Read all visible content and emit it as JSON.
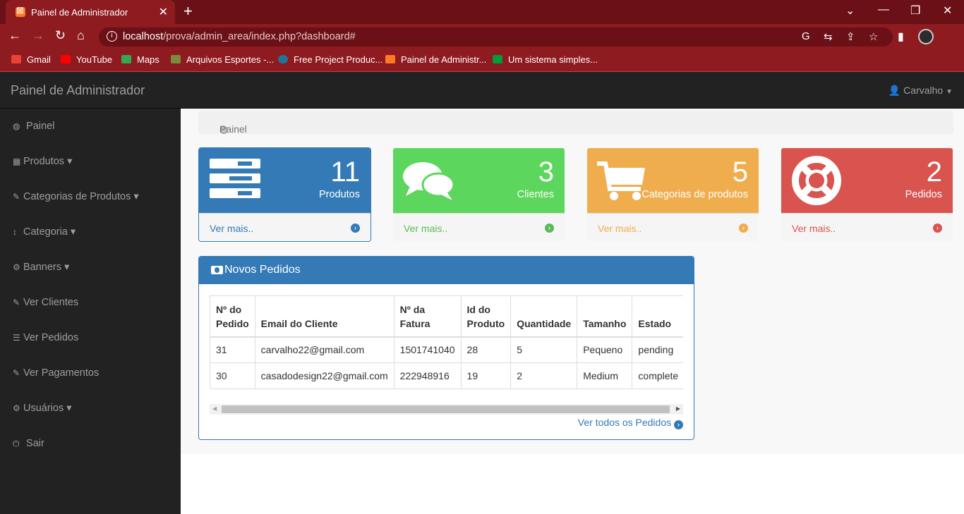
{
  "browser": {
    "tab_title": "Painel de Administrador",
    "tab_close": "✕",
    "new_tab": "+",
    "url_host": "localhost",
    "url_path": "/prova/admin_area/index.php?dashboard#",
    "bookmarks": [
      {
        "label": "Gmail",
        "color": "#ea4335"
      },
      {
        "label": "YouTube",
        "color": "#ff0000"
      },
      {
        "label": "Maps",
        "color": "#34a853"
      },
      {
        "label": "Arquivos Esportes -...",
        "color": "#7a8c3a"
      },
      {
        "label": "Free Project Produc...",
        "color": "#21759b"
      },
      {
        "label": "Painel de Administr...",
        "color": "#fb7a24"
      },
      {
        "label": "Um sistema simples...",
        "color": "#009b3a"
      }
    ]
  },
  "app": {
    "brand": "Painel de Administrador",
    "user": "Carvalho"
  },
  "sidebar": {
    "items": [
      {
        "label": "Painel",
        "icon": "dashboard-icon",
        "glyph": "◍"
      },
      {
        "label": "Produtos",
        "icon": "table-icon",
        "glyph": "▦"
      },
      {
        "label": "Categorias de Produtos",
        "icon": "pencil-icon",
        "glyph": "✎"
      },
      {
        "label": "Categoria",
        "icon": "resize-vertical-icon",
        "glyph": "↕"
      },
      {
        "label": "Banners",
        "icon": "cog-icon",
        "glyph": "⚙"
      },
      {
        "label": "Ver Clientes",
        "icon": "edit-icon",
        "glyph": "✎"
      },
      {
        "label": "Ver Pedidos",
        "icon": "list-icon",
        "glyph": "☰"
      },
      {
        "label": "Ver Pagamentos",
        "icon": "pencil-icon",
        "glyph": "✎"
      },
      {
        "label": "Usuários",
        "icon": "gear-icon",
        "glyph": "⚙"
      },
      {
        "label": "Sair",
        "icon": "power-icon",
        "glyph": "⏻"
      }
    ],
    "caret": "▾"
  },
  "breadcrumb": {
    "label": "Painel"
  },
  "cards": [
    {
      "count": "11",
      "label": "Produtos",
      "more": "Ver mais..",
      "color": "#337ab7",
      "text": "#337ab7",
      "icon": "tasks-icon"
    },
    {
      "count": "3",
      "label": "Clientes",
      "more": "Ver mais..",
      "color": "#5cd65c",
      "text": "#5cb85c",
      "icon": "comments-icon"
    },
    {
      "count": "5",
      "label": "Categorias de produtos",
      "more": "Ver mais..",
      "color": "#f0ad4e",
      "text": "#f0ad4e",
      "icon": "shopping-cart-icon"
    },
    {
      "count": "2",
      "label": "Pedidos",
      "more": "Ver mais..",
      "color": "#d9534f",
      "text": "#d9534f",
      "icon": "life-ring-icon"
    }
  ],
  "orders": {
    "title": "Novos Pedidos",
    "headers": [
      "Nº do Pedido",
      "Email do Cliente",
      "Nº da Fatura",
      "Id do Produto",
      "Quantidade",
      "Tamanho",
      "Estado"
    ],
    "rows": [
      [
        "31",
        "carvalho22@gmail.com",
        "1501741040",
        "28",
        "5",
        "Pequeno",
        "pending"
      ],
      [
        "30",
        "casadodesign22@gmail.com",
        "222948916",
        "19",
        "2",
        "Medium",
        "complete"
      ]
    ],
    "view_all": "Ver todos os Pedidos"
  }
}
